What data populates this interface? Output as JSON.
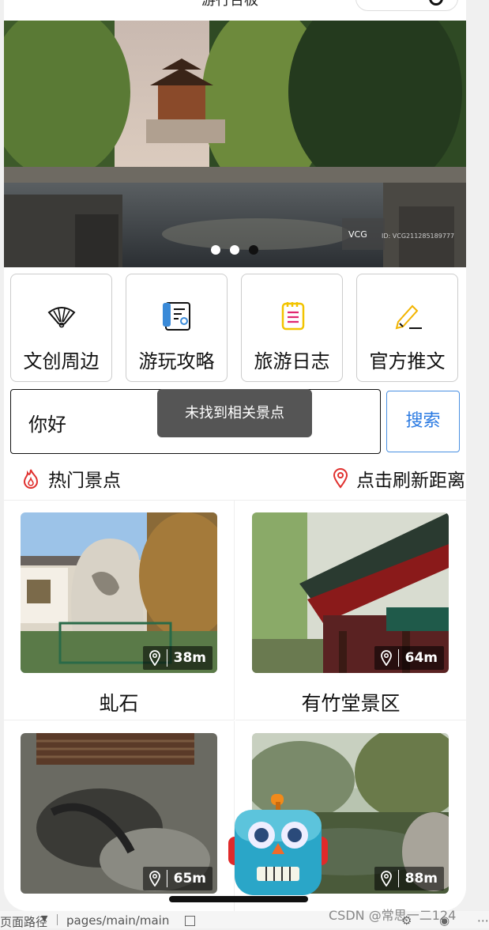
{
  "header": {
    "title": "游行台板"
  },
  "banner": {
    "image_name": "daming-lake-pavilion-photo",
    "watermark_brand": "VCG",
    "watermark_id": "ID: VCG211285189777",
    "dots_count": 3,
    "active_dot": 3
  },
  "quicknav": [
    {
      "label": "文创周边",
      "icon": "fan-icon"
    },
    {
      "label": "游玩攻略",
      "icon": "map-guide-icon"
    },
    {
      "label": "旅游日志",
      "icon": "notepad-icon"
    },
    {
      "label": "官方推文",
      "icon": "pencil-edit-icon"
    }
  ],
  "search": {
    "value": "你好",
    "button_label": "搜索"
  },
  "toast": {
    "message": "未找到相关景点"
  },
  "section": {
    "hot_label": "热门景点",
    "refresh_label": "点击刷新距离"
  },
  "spots": [
    {
      "name": "虬石",
      "distance": "38m"
    },
    {
      "name": "有竹堂景区",
      "distance": "64m"
    },
    {
      "name": "",
      "distance": "65m"
    },
    {
      "name": "",
      "distance": "88m"
    }
  ],
  "footer": {
    "path_label": "页面路径",
    "path": "pages/main/main",
    "watermark": "CSDN @常思一二124"
  },
  "colors": {
    "accent_red": "#e0302e",
    "accent_blue": "#2a7ae2",
    "toast_bg": "#555555"
  }
}
